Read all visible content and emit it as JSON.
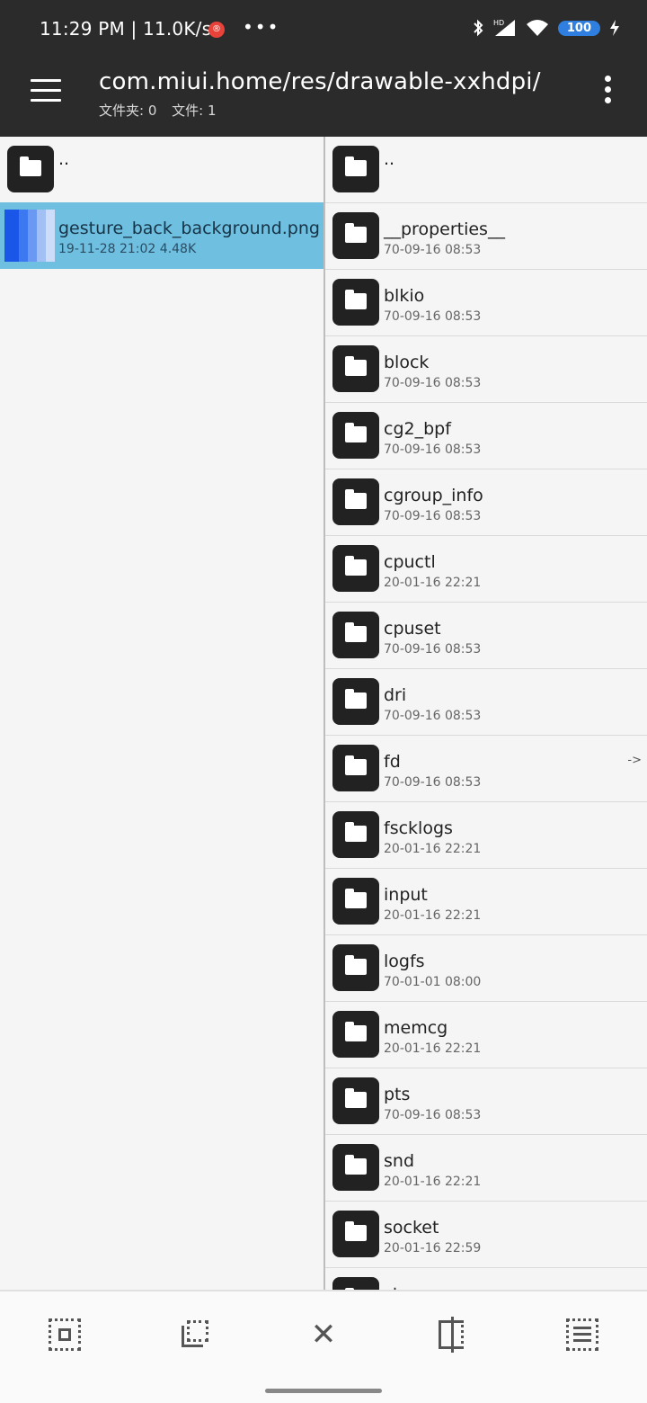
{
  "status_bar": {
    "time": "11:29 PM",
    "speed": "11.0K/s",
    "rec_badge": "®",
    "more": "•••",
    "battery": "100"
  },
  "app_bar": {
    "path": "com.miui.home/res/drawable-xxhdpi/",
    "folders_label": "文件夹: 0",
    "files_label": "文件: 1"
  },
  "left_panel": {
    "up_name": "..",
    "selected_file": {
      "name": "gesture_back_background.png",
      "meta": "19-11-28 21:02  4.48K"
    }
  },
  "right_panel": {
    "up_name": "..",
    "items": [
      {
        "name": "__properties__",
        "meta": "70-09-16 08:53",
        "link": ""
      },
      {
        "name": "blkio",
        "meta": "70-09-16 08:53",
        "link": ""
      },
      {
        "name": "block",
        "meta": "70-09-16 08:53",
        "link": ""
      },
      {
        "name": "cg2_bpf",
        "meta": "70-09-16 08:53",
        "link": ""
      },
      {
        "name": "cgroup_info",
        "meta": "70-09-16 08:53",
        "link": ""
      },
      {
        "name": "cpuctl",
        "meta": "20-01-16 22:21",
        "link": ""
      },
      {
        "name": "cpuset",
        "meta": "70-09-16 08:53",
        "link": ""
      },
      {
        "name": "dri",
        "meta": "70-09-16 08:53",
        "link": ""
      },
      {
        "name": "fd",
        "meta": "70-09-16 08:53",
        "link": "->"
      },
      {
        "name": "fscklogs",
        "meta": "20-01-16 22:21",
        "link": ""
      },
      {
        "name": "input",
        "meta": "20-01-16 22:21",
        "link": ""
      },
      {
        "name": "logfs",
        "meta": "70-01-01 08:00",
        "link": ""
      },
      {
        "name": "memcg",
        "meta": "20-01-16 22:21",
        "link": ""
      },
      {
        "name": "pts",
        "meta": "70-09-16 08:53",
        "link": ""
      },
      {
        "name": "snd",
        "meta": "20-01-16 22:21",
        "link": ""
      },
      {
        "name": "socket",
        "meta": "20-01-16 22:59",
        "link": ""
      },
      {
        "name": "stune",
        "meta": "",
        "link": ""
      }
    ]
  },
  "toolbar": {
    "close_label": "✕"
  }
}
